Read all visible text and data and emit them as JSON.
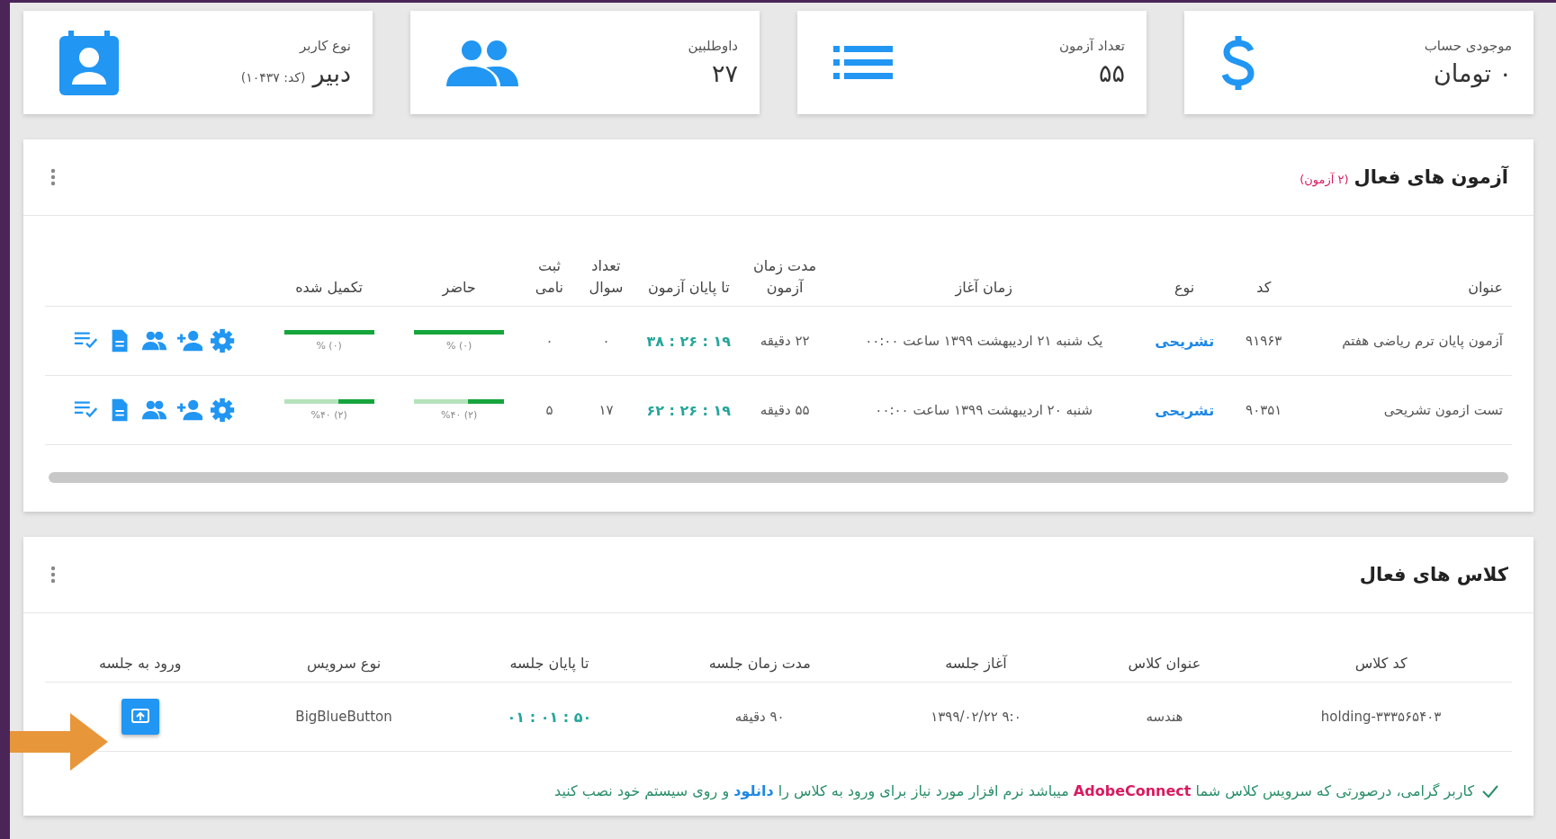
{
  "cards": [
    {
      "kind": "balance",
      "label": "موجودی حساب",
      "value": "۰ تومان"
    },
    {
      "kind": "exams",
      "label": "تعداد آزمون",
      "value": "۵۵"
    },
    {
      "kind": "candidates",
      "label": "داوطلبین",
      "value": "۲۷"
    },
    {
      "kind": "user",
      "label": "نوع کاربر",
      "value": "دبیر",
      "note": "(کد: ۱۰۴۳۷)"
    }
  ],
  "exams_panel": {
    "title": "آزمون های فعال",
    "count": "(۲ آزمون)",
    "columns": [
      "عنوان",
      "کد",
      "نوع",
      "زمان آغاز",
      "مدت زمان آزمون",
      "تا پایان آزمون",
      "تعداد سوال",
      "ثبت نامی",
      "حاضر",
      "تکمیل شده"
    ],
    "rows": [
      {
        "title": "آزمون پایان ترم ریاضی هفتم",
        "code": "۹۱۹۶۳",
        "type": "تشریحی",
        "start": "یک شنبه ۲۱ اردیبهشت ۱۳۹۹ ساعت ۰۰:۰۰",
        "duration": "۲۲ دقیقه",
        "remaining": "۳۸ : ۲۶ : ۱۹",
        "questions": "۰",
        "registered": "۰",
        "present": {
          "level": 1,
          "label": "% (۰)"
        },
        "completed": {
          "level": 1,
          "label": "% (۰)"
        }
      },
      {
        "title": "تست ازمون تشریحی",
        "code": "۹۰۳۵۱",
        "type": "تشریحی",
        "start": "شنبه ۲۰ اردیبهشت ۱۳۹۹ ساعت ۰۰:۰۰",
        "duration": "۵۵ دقیقه",
        "remaining": "۶۲ : ۲۶ : ۱۹",
        "questions": "۱۷",
        "registered": "۵",
        "present": {
          "level": 0.4,
          "label": "%۴۰ (۲)"
        },
        "completed": {
          "level": 0.4,
          "label": "%۴۰ (۲)"
        }
      }
    ]
  },
  "classes_panel": {
    "title": "کلاس های فعال",
    "columns": [
      "کد کلاس",
      "عنوان کلاس",
      "آغاز جلسه",
      "مدت زمان جلسه",
      "تا پایان جلسه",
      "نوع سرویس",
      "ورود به جلسه"
    ],
    "rows": [
      {
        "code": "holding-۳۳۳۵۶۵۴۰۳",
        "title": "هندسه",
        "start": "۱۳۹۹/۰۲/۲۲ ۹:۰",
        "duration": "۹۰ دقیقه",
        "remaining": "۰۱ : ۰۱ : ۵۰",
        "service": "BigBlueButton"
      }
    ],
    "note": [
      {
        "kind": "text",
        "text": "کاربر گرامی، درصورتی که سرویس کلاس شما "
      },
      {
        "kind": "highlight",
        "text": "AdobeConnect"
      },
      {
        "kind": "text",
        "text": " میباشد نرم افزار مورد نیاز برای ورود به کلاس را "
      },
      {
        "kind": "link",
        "text": "دانلود"
      },
      {
        "kind": "text",
        "text": " و روی سیستم خود نصب کنید"
      }
    ]
  }
}
